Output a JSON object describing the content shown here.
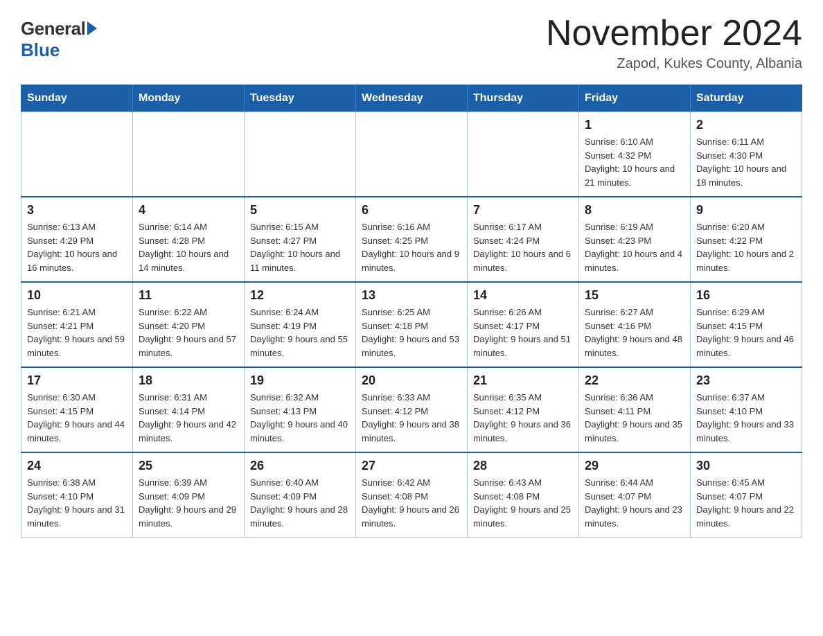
{
  "header": {
    "logo_general": "General",
    "logo_blue": "Blue",
    "month_title": "November 2024",
    "subtitle": "Zapod, Kukes County, Albania"
  },
  "calendar": {
    "days_of_week": [
      "Sunday",
      "Monday",
      "Tuesday",
      "Wednesday",
      "Thursday",
      "Friday",
      "Saturday"
    ],
    "weeks": [
      [
        {
          "day": "",
          "sunrise": "",
          "sunset": "",
          "daylight": ""
        },
        {
          "day": "",
          "sunrise": "",
          "sunset": "",
          "daylight": ""
        },
        {
          "day": "",
          "sunrise": "",
          "sunset": "",
          "daylight": ""
        },
        {
          "day": "",
          "sunrise": "",
          "sunset": "",
          "daylight": ""
        },
        {
          "day": "",
          "sunrise": "",
          "sunset": "",
          "daylight": ""
        },
        {
          "day": "1",
          "sunrise": "Sunrise: 6:10 AM",
          "sunset": "Sunset: 4:32 PM",
          "daylight": "Daylight: 10 hours and 21 minutes."
        },
        {
          "day": "2",
          "sunrise": "Sunrise: 6:11 AM",
          "sunset": "Sunset: 4:30 PM",
          "daylight": "Daylight: 10 hours and 18 minutes."
        }
      ],
      [
        {
          "day": "3",
          "sunrise": "Sunrise: 6:13 AM",
          "sunset": "Sunset: 4:29 PM",
          "daylight": "Daylight: 10 hours and 16 minutes."
        },
        {
          "day": "4",
          "sunrise": "Sunrise: 6:14 AM",
          "sunset": "Sunset: 4:28 PM",
          "daylight": "Daylight: 10 hours and 14 minutes."
        },
        {
          "day": "5",
          "sunrise": "Sunrise: 6:15 AM",
          "sunset": "Sunset: 4:27 PM",
          "daylight": "Daylight: 10 hours and 11 minutes."
        },
        {
          "day": "6",
          "sunrise": "Sunrise: 6:16 AM",
          "sunset": "Sunset: 4:25 PM",
          "daylight": "Daylight: 10 hours and 9 minutes."
        },
        {
          "day": "7",
          "sunrise": "Sunrise: 6:17 AM",
          "sunset": "Sunset: 4:24 PM",
          "daylight": "Daylight: 10 hours and 6 minutes."
        },
        {
          "day": "8",
          "sunrise": "Sunrise: 6:19 AM",
          "sunset": "Sunset: 4:23 PM",
          "daylight": "Daylight: 10 hours and 4 minutes."
        },
        {
          "day": "9",
          "sunrise": "Sunrise: 6:20 AM",
          "sunset": "Sunset: 4:22 PM",
          "daylight": "Daylight: 10 hours and 2 minutes."
        }
      ],
      [
        {
          "day": "10",
          "sunrise": "Sunrise: 6:21 AM",
          "sunset": "Sunset: 4:21 PM",
          "daylight": "Daylight: 9 hours and 59 minutes."
        },
        {
          "day": "11",
          "sunrise": "Sunrise: 6:22 AM",
          "sunset": "Sunset: 4:20 PM",
          "daylight": "Daylight: 9 hours and 57 minutes."
        },
        {
          "day": "12",
          "sunrise": "Sunrise: 6:24 AM",
          "sunset": "Sunset: 4:19 PM",
          "daylight": "Daylight: 9 hours and 55 minutes."
        },
        {
          "day": "13",
          "sunrise": "Sunrise: 6:25 AM",
          "sunset": "Sunset: 4:18 PM",
          "daylight": "Daylight: 9 hours and 53 minutes."
        },
        {
          "day": "14",
          "sunrise": "Sunrise: 6:26 AM",
          "sunset": "Sunset: 4:17 PM",
          "daylight": "Daylight: 9 hours and 51 minutes."
        },
        {
          "day": "15",
          "sunrise": "Sunrise: 6:27 AM",
          "sunset": "Sunset: 4:16 PM",
          "daylight": "Daylight: 9 hours and 48 minutes."
        },
        {
          "day": "16",
          "sunrise": "Sunrise: 6:29 AM",
          "sunset": "Sunset: 4:15 PM",
          "daylight": "Daylight: 9 hours and 46 minutes."
        }
      ],
      [
        {
          "day": "17",
          "sunrise": "Sunrise: 6:30 AM",
          "sunset": "Sunset: 4:15 PM",
          "daylight": "Daylight: 9 hours and 44 minutes."
        },
        {
          "day": "18",
          "sunrise": "Sunrise: 6:31 AM",
          "sunset": "Sunset: 4:14 PM",
          "daylight": "Daylight: 9 hours and 42 minutes."
        },
        {
          "day": "19",
          "sunrise": "Sunrise: 6:32 AM",
          "sunset": "Sunset: 4:13 PM",
          "daylight": "Daylight: 9 hours and 40 minutes."
        },
        {
          "day": "20",
          "sunrise": "Sunrise: 6:33 AM",
          "sunset": "Sunset: 4:12 PM",
          "daylight": "Daylight: 9 hours and 38 minutes."
        },
        {
          "day": "21",
          "sunrise": "Sunrise: 6:35 AM",
          "sunset": "Sunset: 4:12 PM",
          "daylight": "Daylight: 9 hours and 36 minutes."
        },
        {
          "day": "22",
          "sunrise": "Sunrise: 6:36 AM",
          "sunset": "Sunset: 4:11 PM",
          "daylight": "Daylight: 9 hours and 35 minutes."
        },
        {
          "day": "23",
          "sunrise": "Sunrise: 6:37 AM",
          "sunset": "Sunset: 4:10 PM",
          "daylight": "Daylight: 9 hours and 33 minutes."
        }
      ],
      [
        {
          "day": "24",
          "sunrise": "Sunrise: 6:38 AM",
          "sunset": "Sunset: 4:10 PM",
          "daylight": "Daylight: 9 hours and 31 minutes."
        },
        {
          "day": "25",
          "sunrise": "Sunrise: 6:39 AM",
          "sunset": "Sunset: 4:09 PM",
          "daylight": "Daylight: 9 hours and 29 minutes."
        },
        {
          "day": "26",
          "sunrise": "Sunrise: 6:40 AM",
          "sunset": "Sunset: 4:09 PM",
          "daylight": "Daylight: 9 hours and 28 minutes."
        },
        {
          "day": "27",
          "sunrise": "Sunrise: 6:42 AM",
          "sunset": "Sunset: 4:08 PM",
          "daylight": "Daylight: 9 hours and 26 minutes."
        },
        {
          "day": "28",
          "sunrise": "Sunrise: 6:43 AM",
          "sunset": "Sunset: 4:08 PM",
          "daylight": "Daylight: 9 hours and 25 minutes."
        },
        {
          "day": "29",
          "sunrise": "Sunrise: 6:44 AM",
          "sunset": "Sunset: 4:07 PM",
          "daylight": "Daylight: 9 hours and 23 minutes."
        },
        {
          "day": "30",
          "sunrise": "Sunrise: 6:45 AM",
          "sunset": "Sunset: 4:07 PM",
          "daylight": "Daylight: 9 hours and 22 minutes."
        }
      ]
    ]
  }
}
